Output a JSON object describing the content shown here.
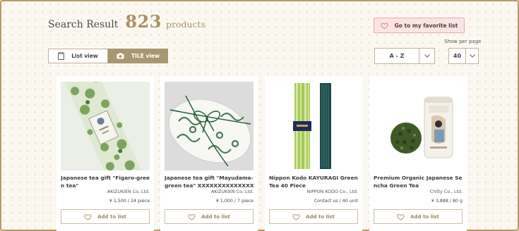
{
  "header": {
    "label": "Search Result",
    "count": "823",
    "unit": "products"
  },
  "favorite_button": "Go to my favorite list",
  "view_toggle": {
    "list": "List view",
    "tile": "TILE view",
    "selected": "tile"
  },
  "show_per_page": {
    "label": "Show per page",
    "value": "40"
  },
  "sort": {
    "value": "A - Z"
  },
  "products": [
    {
      "name": "Japanese tea gift \"Figaro-green tea\"",
      "maker": "AKIZUKIEN Co, Ltd.",
      "price": "¥ 1,500 / 24 piece",
      "add_label": "Add to list"
    },
    {
      "name": "Japanese tea gift \"Mayudama-green tea\" XXXXXXXXXXXXXXX...",
      "maker": "AKIZUKIEN Co, Ltd.",
      "price": "¥ 1,000 / 7 piece",
      "add_label": "Add to list"
    },
    {
      "name": "Nippon Kodo KAYURAGI Green Tea 40 Piece",
      "maker": "NIPPON KODO Co., Ltd.",
      "price": "Contact us / 40 unit",
      "add_label": "Add to list"
    },
    {
      "name": "Premium Organic Japanese Sencha Green Tea",
      "maker": "Chilty Co., Ltd.",
      "price": "¥ 3,888 / 80 g",
      "add_label": "Add to list"
    }
  ],
  "colors": {
    "accent_gold": "#a89466",
    "tile_active": "#a89872",
    "favorite_bg": "#fbe3e4",
    "favorite_border": "#e7a7ad"
  },
  "icons": {
    "favorite": "heart-icon",
    "list_view": "clipboard-icon",
    "tile_view": "camera-icon",
    "dropdown": "chevron-down-icon",
    "add_to_list": "heart-icon"
  }
}
